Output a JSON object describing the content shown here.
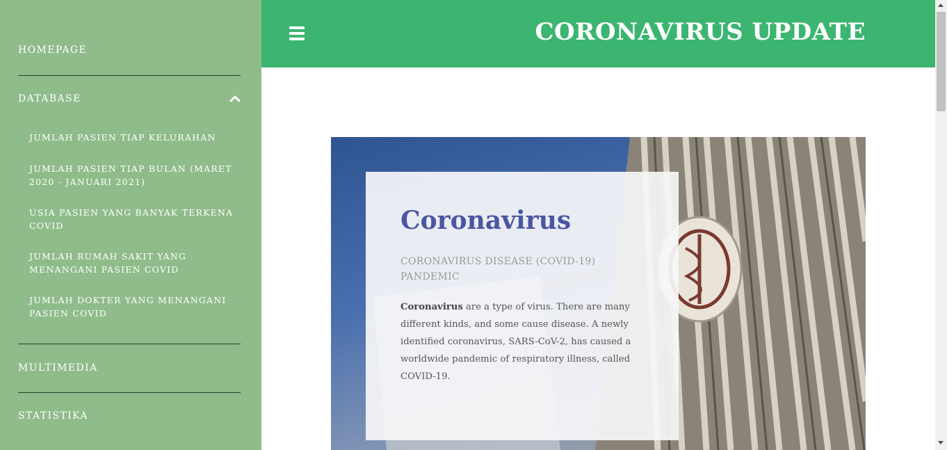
{
  "header": {
    "title": "CORONAVIRUS UPDATE",
    "menu_icon": "hamburger-menu-icon",
    "color": "#3cb571"
  },
  "sidebar": {
    "color": "#8fbc8a",
    "items": [
      {
        "label": "HOMEPAGE"
      },
      {
        "label": "DATABASE",
        "expanded": true,
        "icon": "chevron-up-icon"
      },
      {
        "label": "MULTIMEDIA"
      },
      {
        "label": "STATISTIKA"
      }
    ],
    "database_subitems": [
      {
        "label": "JUMLAH PASIEN TIAP KELURAHAN"
      },
      {
        "label": "JUMLAH PASIEN TIAP BULAN (MARET 2020 - JANUARI 2021)"
      },
      {
        "label": "USIA PASIEN YANG BANYAK TERKENA COVID"
      },
      {
        "label": "JUMLAH RUMAH SAKIT YANG MENANGANI PASIEN COVID"
      },
      {
        "label": "JUMLAH DOKTER YANG MENANGANI PASIEN COVID"
      }
    ]
  },
  "hero": {
    "title": "Coronavirus",
    "subtitle": "CORONAVIRUS DISEASE (COVID-19) PANDEMIC",
    "text_bold": "Coronavirus",
    "text_rest": " are a type of virus. There are many different kinds, and some cause disease. A newly identified coronavirus, SARS-CoV-2, has caused a worldwide pandemic of respiratory illness, called COVID-19.",
    "title_color": "#4a56a0"
  }
}
